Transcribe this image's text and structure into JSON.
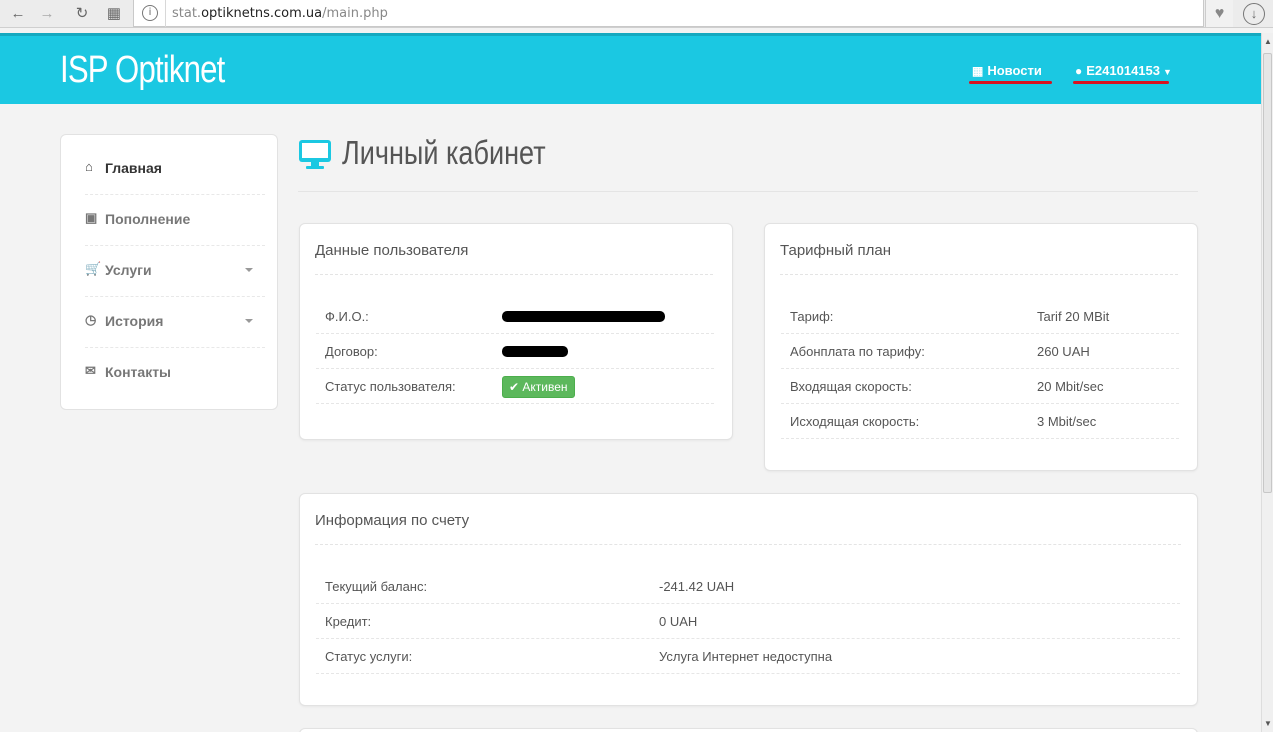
{
  "browser": {
    "url_prefix": "stat.",
    "url_domain": "optiknetns.com.ua",
    "url_path": "/main.php"
  },
  "header": {
    "brand": "ISP Optiknet",
    "news_label": "Новости",
    "user_label": "E241014153",
    "accent_color": "#1bc8e2"
  },
  "sidebar": {
    "items": [
      {
        "label": "Главная",
        "icon": "home-icon",
        "active": true
      },
      {
        "label": "Пополнение",
        "icon": "money-icon"
      },
      {
        "label": "Услуги",
        "icon": "cart-icon",
        "dropdown": true
      },
      {
        "label": "История",
        "icon": "clock-icon",
        "dropdown": true
      },
      {
        "label": "Контакты",
        "icon": "envelope-icon"
      }
    ]
  },
  "page": {
    "title": "Личный кабинет"
  },
  "user_panel": {
    "title": "Данные пользователя",
    "rows": [
      {
        "key": "Ф.И.О.:"
      },
      {
        "key": "Договор:"
      },
      {
        "key": "Статус пользователя:",
        "badge": "Активен"
      }
    ]
  },
  "tariff_panel": {
    "title": "Тарифный план",
    "rows": [
      {
        "key": "Тариф:",
        "value": "Tarif 20 MBit"
      },
      {
        "key": "Абонплата по тарифу:",
        "value": "260 UAH"
      },
      {
        "key": "Входящая скорость:",
        "value": "20 Mbit/sec"
      },
      {
        "key": "Исходящая скорость:",
        "value": "3 Mbit/sec"
      }
    ]
  },
  "account_panel": {
    "title": "Информация по счету",
    "rows": [
      {
        "key": "Текущий баланс:",
        "value": "-241.42 UAH"
      },
      {
        "key": "Кредит:",
        "value": "0 UAH"
      },
      {
        "key": "Статус услуги:",
        "value": "Услуга Интернет недоступна"
      }
    ]
  }
}
